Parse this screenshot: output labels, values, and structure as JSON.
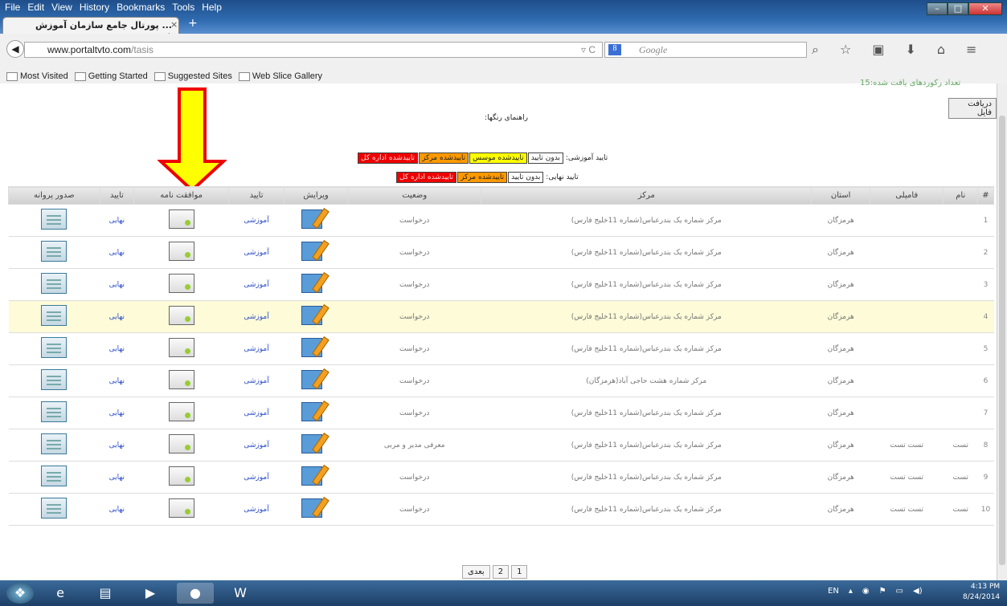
{
  "menu": [
    "File",
    "Edit",
    "View",
    "History",
    "Bookmarks",
    "Tools",
    "Help"
  ],
  "tab": {
    "title": "... پورتال جامع سازمان آموزش فنی",
    "close": "×",
    "new": "+"
  },
  "url": {
    "host": "www.portaltvto.com",
    "path": "/tasis"
  },
  "search": {
    "engine": "8",
    "placeholder": "Google"
  },
  "bookmarks": [
    "Most Visited",
    "Getting Started",
    "Suggested Sites",
    "Web Slice Gallery"
  ],
  "page": {
    "count_text": "تعداد رکوردهای یافت شده:15",
    "file_button": "دریافت فایل",
    "guide_title": "راهنمای رنگها:",
    "edu_label": "تایید آموزشی:",
    "edu_items": [
      "بدون تایید",
      "تاییدشده موسس",
      "تاییدشده مرکز",
      "تاییدشده اداره کل"
    ],
    "final_label": "تایید نهایی:",
    "final_items": [
      "بدون تایید",
      "تاییدشده مرکز",
      "تاییدشده اداره کل"
    ]
  },
  "table": {
    "headers": [
      "#",
      "نام",
      "فامیلی",
      "استان",
      "مرکز",
      "وضعیت",
      "ویرایش",
      "تایید",
      "موافقت نامه",
      "تایید",
      "صدور پروانه"
    ],
    "rows": [
      {
        "n": "1",
        "name": "",
        "family": "",
        "province": "هرمزگان",
        "center": "مرکز شماره یک بندرعباس(شماره 11خلیج فارس)",
        "status": "درخواست",
        "edu": "آموزشی",
        "final": "نهایی"
      },
      {
        "n": "2",
        "name": "",
        "family": "",
        "province": "هرمزگان",
        "center": "مرکز شماره یک بندرعباس(شماره 11خلیج فارس)",
        "status": "درخواست",
        "edu": "آموزشی",
        "final": "نهایی"
      },
      {
        "n": "3",
        "name": "",
        "family": "",
        "province": "هرمزگان",
        "center": "مرکز شماره یک بندرعباس(شماره 11خلیج فارس)",
        "status": "درخواست",
        "edu": "آموزشی",
        "final": "نهایی"
      },
      {
        "n": "4",
        "name": "",
        "family": "",
        "province": "هرمزگان",
        "center": "مرکز شماره یک بندرعباس(شماره 11خلیج فارس)",
        "status": "درخواست",
        "edu": "آموزشی",
        "final": "نهایی"
      },
      {
        "n": "5",
        "name": "",
        "family": "",
        "province": "هرمزگان",
        "center": "مرکز شماره یک بندرعباس(شماره 11خلیج فارس)",
        "status": "درخواست",
        "edu": "آموزشی",
        "final": "نهایی"
      },
      {
        "n": "6",
        "name": "",
        "family": "",
        "province": "هرمزگان",
        "center": "مرکز شماره هشت حاجی آباد(هرمزگان)",
        "status": "درخواست",
        "edu": "آموزشی",
        "final": "نهایی"
      },
      {
        "n": "7",
        "name": "",
        "family": "",
        "province": "هرمزگان",
        "center": "مرکز شماره یک بندرعباس(شماره 11خلیج فارس)",
        "status": "درخواست",
        "edu": "آموزشی",
        "final": "نهایی"
      },
      {
        "n": "8",
        "name": "تست",
        "family": "تست تست",
        "province": "هرمزگان",
        "center": "مرکز شماره یک بندرعباس(شماره 11خلیج فارس)",
        "status": "معرفی مدیر و مربی",
        "edu": "آموزشی",
        "final": "نهایی"
      },
      {
        "n": "9",
        "name": "تست",
        "family": "تست تست",
        "province": "هرمزگان",
        "center": "مرکز شماره یک بندرعباس(شماره 11خلیج فارس)",
        "status": "درخواست",
        "edu": "آموزشی",
        "final": "نهایی"
      },
      {
        "n": "10",
        "name": "تست",
        "family": "تست تست",
        "province": "هرمزگان",
        "center": "مرکز شماره یک بندرعباس(شماره 11خلیج فارس)",
        "status": "درخواست",
        "edu": "آموزشی",
        "final": "نهایی"
      }
    ]
  },
  "pager": [
    "بعدی",
    "2",
    "1"
  ],
  "taskbar": {
    "lang": "EN",
    "time": "4:13 PM",
    "date": "8/24/2014"
  }
}
